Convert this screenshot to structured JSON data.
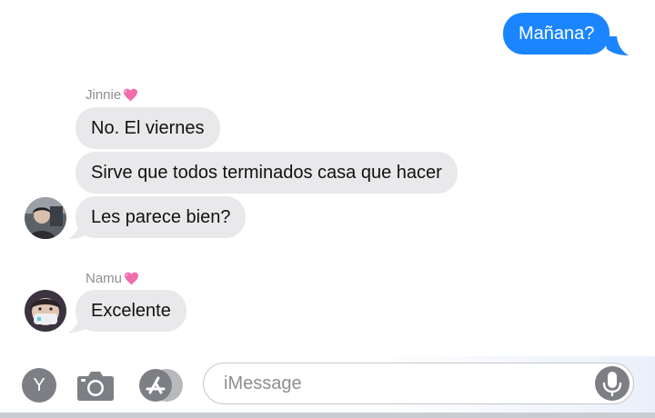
{
  "conversation": {
    "outgoing": [
      {
        "text": "Mañana?"
      }
    ],
    "groups": [
      {
        "sender": "Jinnie",
        "messages": [
          "No. El viernes",
          "Sirve que todos terminados casa que hacer",
          "Les parece bien?"
        ]
      },
      {
        "sender": "Namu",
        "messages": [
          "Excelente"
        ]
      }
    ]
  },
  "composer": {
    "app_button_letter": "Y",
    "placeholder": "iMessage",
    "icons": [
      "camera-icon",
      "app-store-icon",
      "microphone-icon",
      "heart-emoji"
    ]
  },
  "colors": {
    "outgoing_bubble": "#1a85ff",
    "incoming_bubble": "#e9e9eb",
    "sender_name": "#8e8e93"
  }
}
